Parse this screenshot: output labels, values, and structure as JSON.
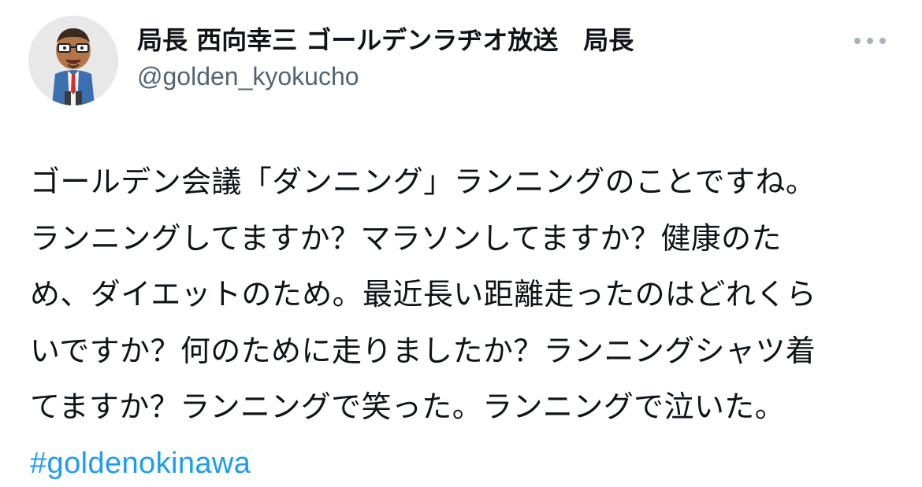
{
  "author": {
    "display_name": "局長 西向幸三 ゴールデンラヂオ放送　局長",
    "handle": "@golden_kyokucho",
    "avatar_icon": "cartoon-man-glasses-avatar"
  },
  "menu": {
    "icon": "more-horizontal-icon"
  },
  "tweet": {
    "lines": [
      "ゴールデン会議「ダンニング」ランニングのことですね。",
      "ランニングしてますか？マラソンしてますか？健康のた",
      "め、ダイエットのため。最近長い距離走ったのはどれくら",
      "いですか？何のために走りましたか？ランニングシャツ着",
      "てますか？ランニングで笑った。ランニングで泣いた。"
    ],
    "hashtag": "#goldenokinawa"
  },
  "colors": {
    "text": "#0f1419",
    "secondary": "#536471",
    "link": "#1d9bf0"
  }
}
